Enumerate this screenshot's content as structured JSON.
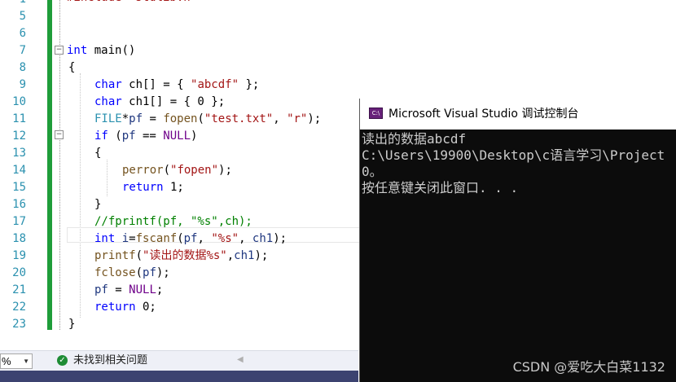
{
  "editor": {
    "line_numbers": [
      "1",
      "5",
      "6",
      "7",
      "8",
      "9",
      "10",
      "11",
      "12",
      "13",
      "14",
      "15",
      "16",
      "17",
      "18",
      "19",
      "20",
      "21",
      "22",
      "23"
    ],
    "top_partial": "#include <stdlib.h>",
    "lines": {
      "l7": [
        "int",
        " main()"
      ],
      "l8": "{",
      "l9": [
        "char",
        " ch[] = { ",
        "\"abcdf\"",
        " };"
      ],
      "l10": [
        "char",
        " ch1[] = { 0 };"
      ],
      "l11": [
        "FILE",
        "*",
        "pf",
        " = ",
        "fopen",
        "(",
        "\"test.txt\"",
        ", ",
        "\"r\"",
        ");"
      ],
      "l12": [
        "if",
        " (",
        "pf",
        " == ",
        "NULL",
        ")"
      ],
      "l13": "{",
      "l14": [
        "perror",
        "(",
        "\"fopen\"",
        ");"
      ],
      "l15": [
        "return",
        " 1;"
      ],
      "l16": "}",
      "l17": "//fprintf(pf, \"%s\",ch);",
      "l18": [
        "int",
        " ",
        "i",
        "=",
        "fscanf",
        "(",
        "pf",
        ", ",
        "\"%s\"",
        ", ",
        "ch1",
        ");"
      ],
      "l19": [
        "printf",
        "(",
        "\"读出的数据%s\"",
        ",",
        "ch1",
        ");"
      ],
      "l20": [
        "fclose",
        "(",
        "pf",
        ");"
      ],
      "l21": [
        "pf",
        " = ",
        "NULL",
        ";"
      ],
      "l22": [
        "return",
        " 0;"
      ],
      "l23": "}"
    }
  },
  "statusbar": {
    "zoom": "%",
    "issues_text": "未找到相关问题"
  },
  "console": {
    "title": "Microsoft Visual Studio 调试控制台",
    "icon_label": "C:\\",
    "output": [
      "读出的数据abcdf",
      "C:\\Users\\19900\\Desktop\\c语言学习\\Project",
      "0。",
      "按任意键关闭此窗口. . ."
    ]
  },
  "watermark": "CSDN @爱吃大白菜1132",
  "colors": {
    "keyword": "#0000ff",
    "type": "#2b91af",
    "string": "#a31515",
    "macro": "#6f008a",
    "function": "#74531f",
    "comment": "#008000",
    "change_bar": "#1f9d3a",
    "console_bg": "#0c0c0c"
  },
  "icons": {
    "fold_open": "minus-box-icon",
    "issues": "check-circle-icon",
    "console": "vs-console-icon"
  }
}
